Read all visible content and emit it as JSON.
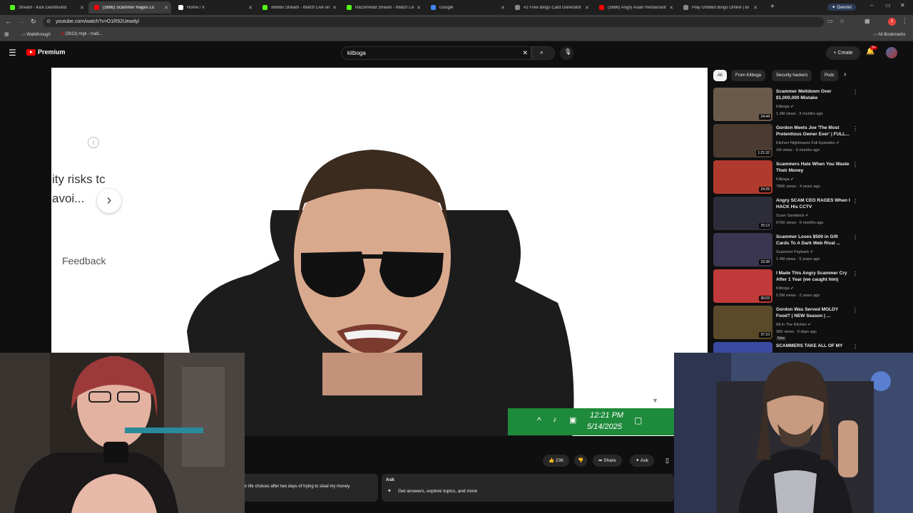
{
  "browser": {
    "tabs": [
      {
        "label": "Stream - Kick Dashboard",
        "color": "#53fc18"
      },
      {
        "label": "(3886) Scammer Rages Lo",
        "color": "#ff0000",
        "active": true
      },
      {
        "label": "Home / X",
        "color": "#ffffff"
      },
      {
        "label": "xMoBx Stream - Watch Live on",
        "color": "#53fc18"
      },
      {
        "label": "RazorRedd Stream - Watch Liv",
        "color": "#53fc18"
      },
      {
        "label": "Google",
        "color": "#4285f4"
      },
      {
        "label": "#1 Free Bingo Card Generator",
        "color": "#888888"
      },
      {
        "label": "(3886) Angry Asian Restaurant",
        "color": "#ff0000"
      },
      {
        "label": "Play Untitled Bingo Online | Bi",
        "color": "#888888"
      }
    ],
    "gemini_label": "Gemini",
    "url": "youtube.com/watch?v=O1R92Uewdyl",
    "bookmarks": [
      "Walkthrough",
      "(3813) mgk - tradi..."
    ],
    "all_bookmarks": "All Bookmarks",
    "notification_badge": "1"
  },
  "youtube": {
    "logo_label": "Premium",
    "search_value": "kitboga",
    "create_label": "Create",
    "notif_count": "9+",
    "chips": [
      "All",
      "From Kitboga",
      "Security hackers",
      "Podc"
    ],
    "recommendations": [
      {
        "title": "Scammer Meltdown Over $1,000,000 Mistake",
        "channel": "Kitboga",
        "meta": "1.3M views · 3 months ago",
        "duration": "24:44",
        "thumb": "#6b5a4a"
      },
      {
        "title": "Gordon Meets Joe 'The Most Pretentious Owner Ever' | FULL...",
        "channel": "Kitchen Nightmares Full Episodes",
        "meta": "1M views · 9 months ago",
        "duration": "1:21:32",
        "thumb": "#4a3a30"
      },
      {
        "title": "Scammers Hate When You Waste Their Money",
        "channel": "Kitboga",
        "meta": "780K views · 4 years ago",
        "duration": "24:29",
        "thumb": "#b03a2e"
      },
      {
        "title": "Angry SCAM CEO RAGES When I HACK His CCTV",
        "channel": "Scam Sandwich",
        "meta": "676K views · 6 months ago",
        "duration": "25:13",
        "thumb": "#2d2d3a"
      },
      {
        "title": "Scammer Loses $500 in Gift Cards To A Dark Web Rival ...",
        "channel": "Scammer Payback",
        "meta": "1.4M views · 5 years ago",
        "duration": "33:38",
        "thumb": "#3a3550"
      },
      {
        "title": "I Made This Angry Scammer Cry After 1 Year (we caught him)",
        "channel": "Kitboga",
        "meta": "5.5M views · 2 years ago",
        "duration": "30:03",
        "thumb": "#c23a3a"
      },
      {
        "title": "Gordon Was Served MOLDY Food? | NEW Season | ...",
        "channel": "All In The Kitchen",
        "meta": "36K views · 6 days ago",
        "badge": "New",
        "duration": "37:10",
        "thumb": "#5a4a2a"
      },
      {
        "title": "SCAMMERS TAKE ALL OF MY",
        "channel": "",
        "meta": "",
        "duration": "",
        "thumb": "#3a4aa0"
      }
    ],
    "video_overlay": {
      "partial_line1": "ity risks tc",
      "partial_line2": "avoi...",
      "feedback": "Feedback"
    },
    "taskbar": {
      "time": "12:21 PM",
      "date": "5/14/2025"
    },
    "actions": {
      "likes": "23K",
      "share": "Share",
      "ask": "Ask"
    },
    "description_snippet": "ir life choices after two days of trying to steal my money.",
    "ask_panel": {
      "title": "Ask",
      "prompt": "Get answers, explore topics, and more"
    }
  }
}
